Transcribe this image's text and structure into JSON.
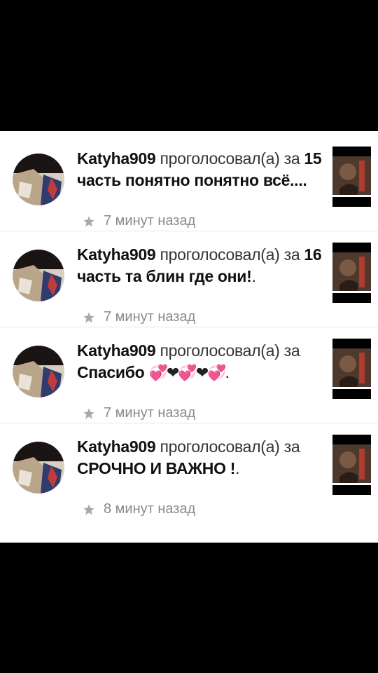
{
  "feed": {
    "items": [
      {
        "username": "Katyha909",
        "verb": "проголосовал(а)",
        "prep": "за",
        "story": "15 часть понятно понятно всё....",
        "suffix": "",
        "time": "7 минут назад"
      },
      {
        "username": "Katyha909",
        "verb": "проголосовал(а)",
        "prep": "за",
        "story": "16 часть та блин где они!",
        "suffix": ".",
        "time": "7 минут назад"
      },
      {
        "username": "Katyha909",
        "verb": "проголосовал(а)",
        "prep": "за",
        "story": "Спасибо",
        "story_emoji": "💞❤💞❤💞",
        "suffix": ".",
        "time": "7 минут назад"
      },
      {
        "username": "Katyha909",
        "verb": "проголосовал(а)",
        "prep": "за",
        "story": "СРОЧНО И ВАЖНО !",
        "suffix": ".",
        "time": "8 минут назад"
      }
    ]
  },
  "icons": {
    "time": "star-icon",
    "avatar": "user-avatar",
    "cover": "story-cover-thumbnail"
  },
  "colors": {
    "background": "#000000",
    "card": "#ffffff",
    "meta": "#8a8a8a",
    "divider": "#e6e6e6"
  }
}
